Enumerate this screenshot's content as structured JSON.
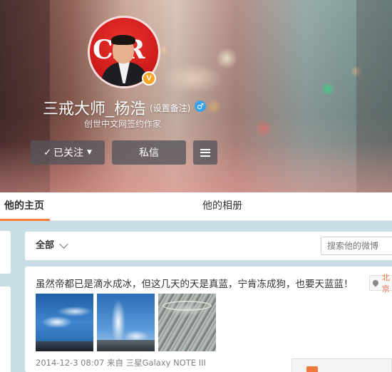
{
  "profile": {
    "name": "三戒大师_杨浩",
    "remark_link": "(设置备注)",
    "gender_symbol": "♂",
    "subtitle": "创世中文网签约作家",
    "verified_badge": "V",
    "avatar_logo_text": "CIR"
  },
  "actions": {
    "follow_label": "已关注",
    "follow_check": "✓",
    "follow_caret": "▼",
    "message_label": "私信"
  },
  "tabs": {
    "home": "他的主页",
    "album": "他的相册"
  },
  "feed_filter": {
    "selected": "全部",
    "search_placeholder": "搜索他的微博"
  },
  "post": {
    "text": "虽然帝都已是滴水成冰，但这几天的天是真蓝，宁肯冻成狗，也要天蓝蓝！",
    "location_label": "北京",
    "meta": "2014-12-3 08:07 来自 三星Galaxy NOTE III"
  },
  "colors": {
    "accent": "#fa7d3c",
    "verified": "#f5a623",
    "gender_male": "#3aa3e6",
    "page_bg": "#c8dde6"
  }
}
